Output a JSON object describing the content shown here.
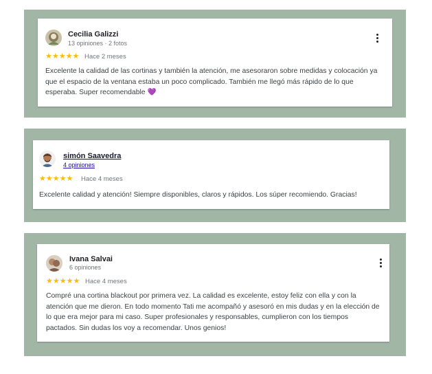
{
  "reviews": [
    {
      "name": "Cecilia Galizzi",
      "meta": "13 opiniones · 2 fotos",
      "stars": "★★★★★",
      "when": "Hace 2 meses",
      "text": "Excelente la calidad de las cortinas y también la atención, me asesoraron sobre medidas y colocación ya que el espacio de la ventana estaba un poco complicado. También me llegó más rápido de lo que esperaba. Super recomendable 💜",
      "avatar_icon": "profile-photo"
    },
    {
      "name": "simón Saavedra",
      "meta": "4 opiniones",
      "stars": "★★★★★",
      "when": "Hace 4 meses",
      "text": "Excelente calidad y atención! Siempre disponibles, claros y rápidos. Los súper recomiendo. Gracias!",
      "avatar_icon": "profile-photo"
    },
    {
      "name": "Ivana Salvai",
      "meta": "6 opiniones",
      "stars": "★★★★★",
      "when": "Hace 4 meses",
      "text": "Compré una cortina blackout por primera vez. La calidad es excelente, estoy feliz con ella y con la atención que me dieron. En todo momento Tati me acompañó y asesoró en mis dudas y en la elección de lo que era mejor para mi caso. Super profesionales y responsables, cumplieron con los tiempos pactados. Sin dudas los voy a recomendar. Unos genios!",
      "avatar_icon": "profile-photo"
    }
  ],
  "colors": {
    "panel": "#a2b6a6",
    "star": "#fbbc04"
  }
}
